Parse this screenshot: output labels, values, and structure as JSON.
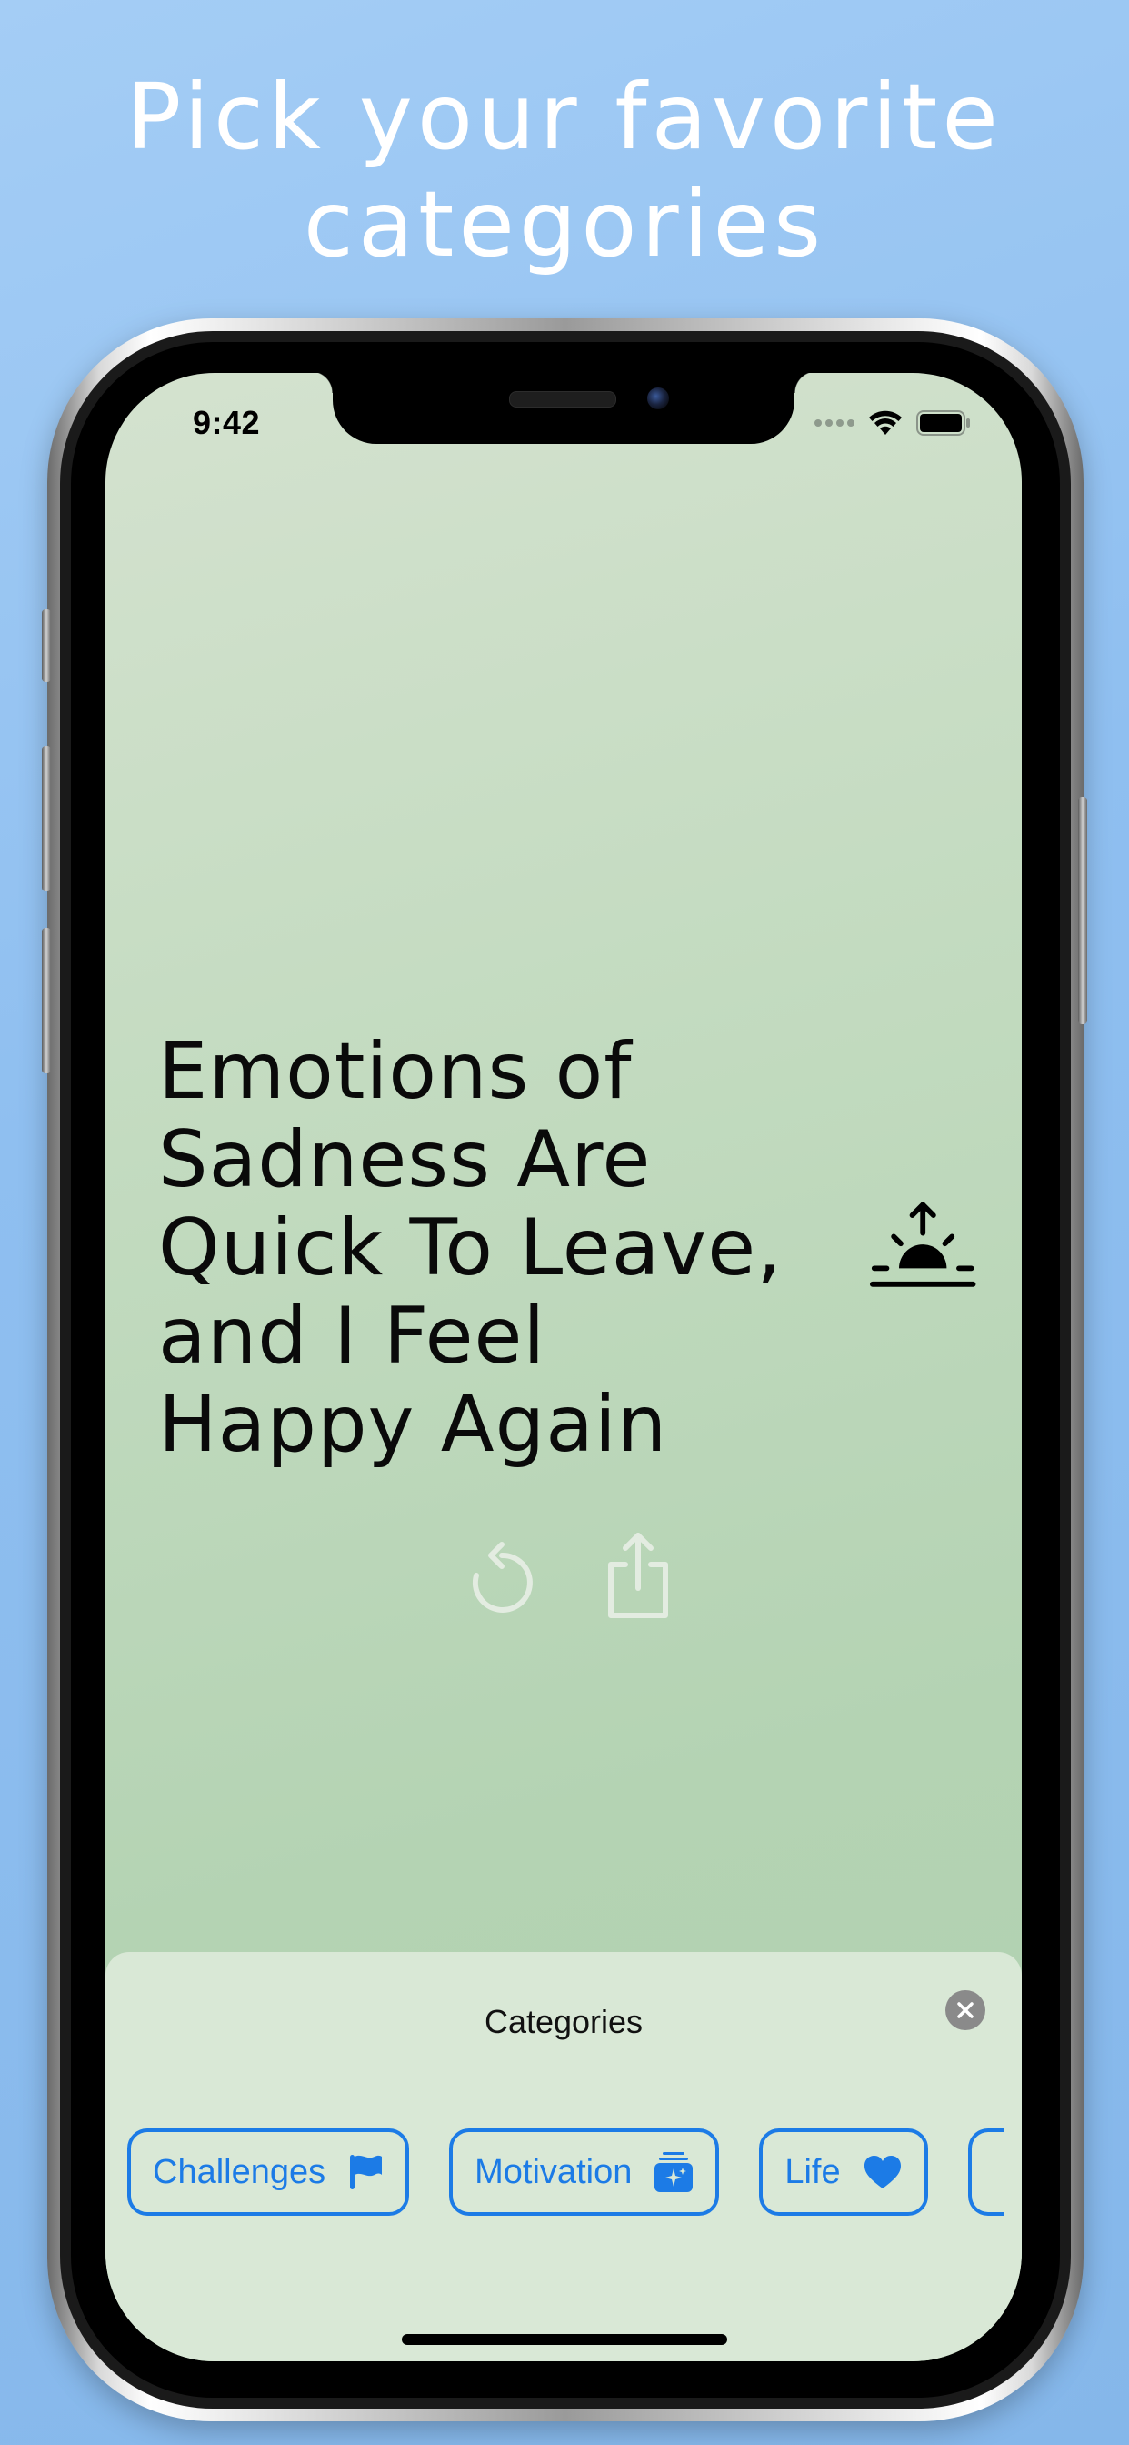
{
  "headline": {
    "line1": "Pick your favorite",
    "line2": "categories"
  },
  "status_bar": {
    "time": "9:42"
  },
  "quote": {
    "lines": [
      "Emotions of",
      "Sadness Are",
      "Quick To Leave,",
      "and I Feel",
      "Happy Again"
    ],
    "icon": "sunrise-icon"
  },
  "actions": {
    "refresh_icon": "refresh-icon",
    "share_icon": "share-icon"
  },
  "categories_sheet": {
    "title": "Categories",
    "close_icon": "close-icon",
    "chips": [
      {
        "label": "Challenges",
        "icon": "flag-icon"
      },
      {
        "label": "Motivation",
        "icon": "sparkles-box-icon"
      },
      {
        "label": "Life",
        "icon": "heart-icon"
      }
    ]
  },
  "colors": {
    "background": "#8fbff0",
    "screen_bg": "#c3dbc0",
    "sheet_bg": "#d9e8d6",
    "accent": "#1c7be6"
  }
}
